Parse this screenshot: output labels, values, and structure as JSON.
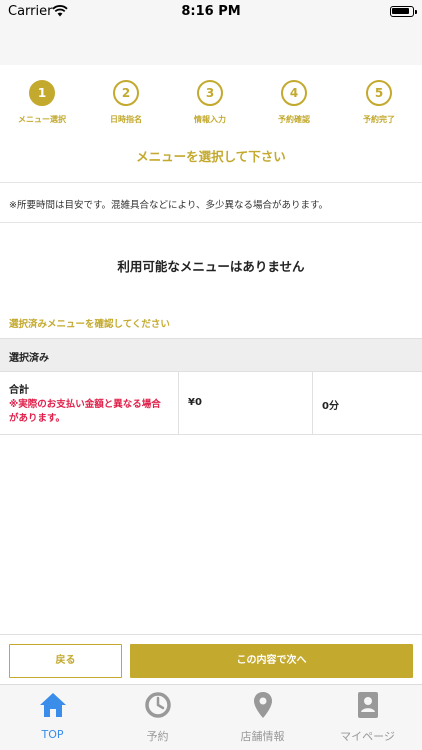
{
  "status_bar": {
    "carrier": "Carrier",
    "time": "8:16 PM"
  },
  "steps": [
    {
      "number": "1",
      "label": "メニュー選択"
    },
    {
      "number": "2",
      "label": "日時指名"
    },
    {
      "number": "3",
      "label": "情報入力"
    },
    {
      "number": "4",
      "label": "予約確認"
    },
    {
      "number": "5",
      "label": "予約完了"
    }
  ],
  "heading": "メニューを選択して下さい",
  "note": "※所要時間は目安です。混雑具合などにより、多少異なる場合があります。",
  "empty_message": "利用可能なメニューはありません",
  "confirm_label": "選択済みメニューを確認してください",
  "selected_section": {
    "header": "選択済み",
    "total_label": "合計",
    "warning": "※実際のお支払い金額と異なる場合があります。",
    "price": "¥0",
    "duration": "0分"
  },
  "buttons": {
    "back": "戻る",
    "next": "この内容で次へ"
  },
  "tabs": [
    {
      "label": "TOP",
      "icon": "home-icon"
    },
    {
      "label": "予約",
      "icon": "clock-icon"
    },
    {
      "label": "店舗情報",
      "icon": "location-pin-icon"
    },
    {
      "label": "マイページ",
      "icon": "profile-card-icon"
    }
  ],
  "colors": {
    "accent": "#c3a92e",
    "warning": "#e0204a",
    "tab_active": "#3a8de8",
    "tab_inactive": "#999999"
  }
}
